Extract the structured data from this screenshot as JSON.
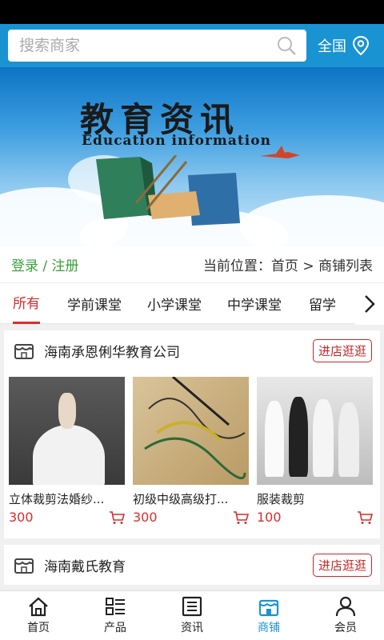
{
  "search": {
    "placeholder": "搜索商家"
  },
  "header": {
    "region_label": "全国"
  },
  "banner": {
    "title": "教育资讯",
    "subtitle": "Education information"
  },
  "breadcrumb": {
    "login": "登录",
    "sep": " / ",
    "register": "注册",
    "position": "当前位置：首页 > 商铺列表"
  },
  "tabs": [
    "所有",
    "学前课堂",
    "小学课堂",
    "中学课堂",
    "留学"
  ],
  "shops": [
    {
      "name": "海南承恩俐华教育公司",
      "enter_label": "进店逛逛",
      "products": [
        {
          "name": "立体裁剪法婚纱...",
          "price": "300"
        },
        {
          "name": "初级中级高级打...",
          "price": "300"
        },
        {
          "name": "服装裁剪",
          "price": "100"
        }
      ]
    },
    {
      "name": "海南戴氏教育",
      "enter_label": "进店逛逛"
    }
  ],
  "tabbar": [
    {
      "label": "首页",
      "icon": "home-icon"
    },
    {
      "label": "产品",
      "icon": "list-icon"
    },
    {
      "label": "资讯",
      "icon": "news-icon"
    },
    {
      "label": "商铺",
      "icon": "shop-icon"
    },
    {
      "label": "会员",
      "icon": "user-icon"
    }
  ],
  "colors": {
    "primary": "#1a93d3",
    "accent": "#d92c2c",
    "login": "#3aa03a"
  }
}
